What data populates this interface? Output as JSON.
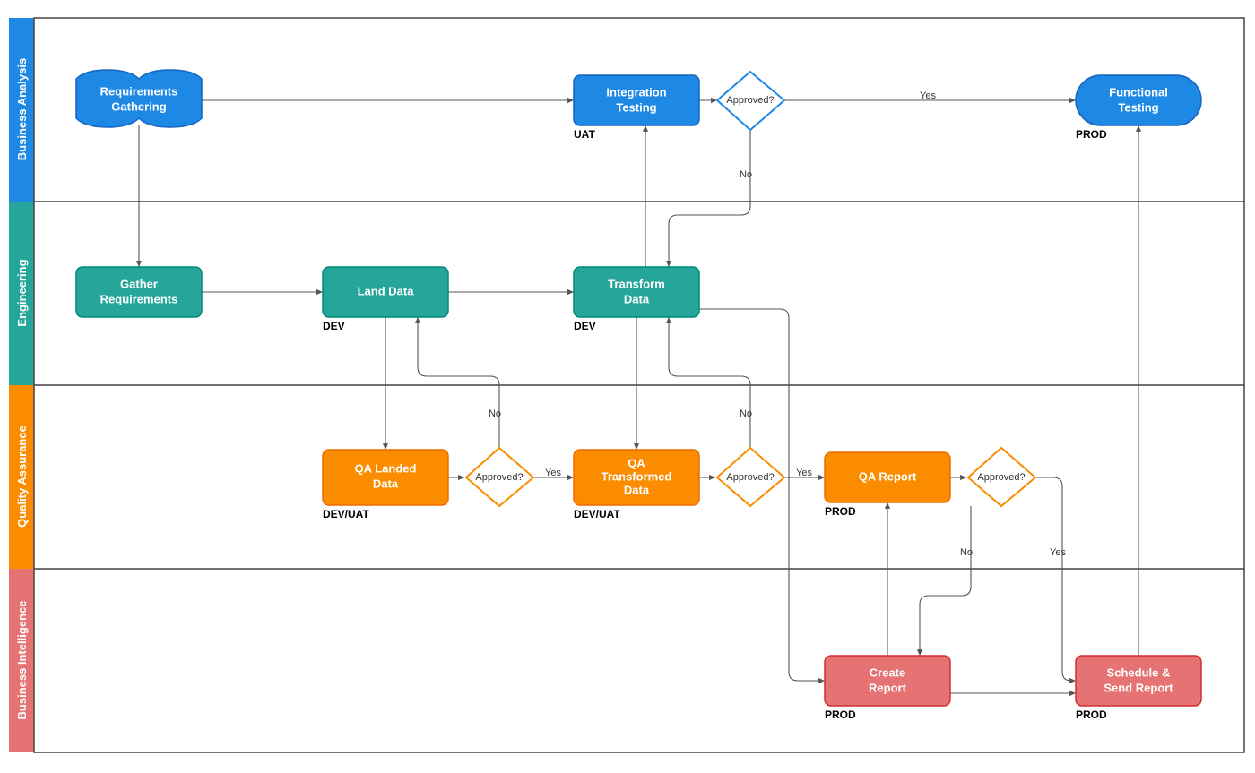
{
  "lanes": [
    {
      "id": "ba",
      "title": "Business Analysis",
      "color": "#1E88E5"
    },
    {
      "id": "eng",
      "title": "Engineering",
      "color": "#26A69A"
    },
    {
      "id": "qa",
      "title": "Quality Assurance",
      "color": "#FB8C00"
    },
    {
      "id": "bi",
      "title": "Business Intelligence",
      "color": "#E57373"
    }
  ],
  "nodes": {
    "req": {
      "l1": "Requirements",
      "l2": "Gathering",
      "env": ""
    },
    "it": {
      "l1": "Integration",
      "l2": "Testing",
      "env": "UAT"
    },
    "ft": {
      "l1": "Functional",
      "l2": "Testing",
      "env": "PROD"
    },
    "gr": {
      "l1": "Gather",
      "l2": "Requirements",
      "env": ""
    },
    "ld": {
      "l1": "Land Data",
      "l2": "",
      "env": "DEV"
    },
    "td": {
      "l1": "Transform",
      "l2": "Data",
      "env": "DEV"
    },
    "qal": {
      "l1": "QA Landed",
      "l2": "Data",
      "env": "DEV/UAT"
    },
    "qat": {
      "l1": "QA",
      "l2": "Transformed",
      "l3": "Data",
      "env": "DEV/UAT"
    },
    "qar": {
      "l1": "QA Report",
      "l2": "",
      "env": "PROD"
    },
    "cr": {
      "l1": "Create",
      "l2": "Report",
      "env": "PROD"
    },
    "ssr": {
      "l1": "Schedule &",
      "l2": "Send Report",
      "env": "PROD"
    }
  },
  "decision": "Approved?",
  "edgeLabels": {
    "yes": "Yes",
    "no": "No"
  }
}
